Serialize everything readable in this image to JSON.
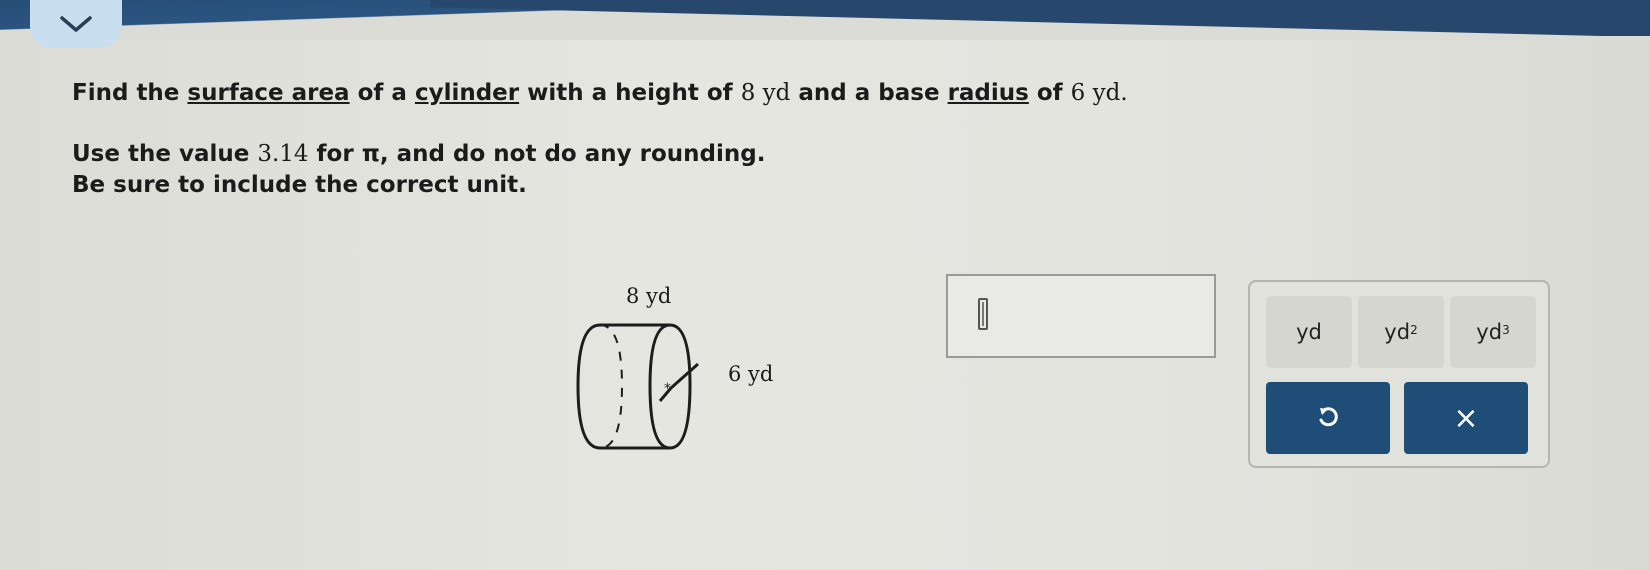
{
  "header": {
    "collapse_icon": "chevron-down-icon"
  },
  "question": {
    "line1_prefix": "Find the ",
    "term_surface_area": "surface area",
    "line1_mid1": " of a ",
    "term_cylinder": "cylinder",
    "line1_mid2": " with a height of ",
    "height_value": "8 yd",
    "line1_mid3": " and a base ",
    "term_radius": "radius",
    "line1_mid4": " of ",
    "radius_value": "6 yd",
    "line1_end": ".",
    "line2_prefix": "Use the value ",
    "pi_value": "3.14",
    "line2_suffix": " for π, and do not do any rounding.",
    "line3": "Be sure to include the correct unit."
  },
  "figure": {
    "height_label": "8 yd",
    "radius_label": "6 yd"
  },
  "answer": {
    "value": ""
  },
  "keypad": {
    "units": [
      {
        "base": "yd",
        "exp": ""
      },
      {
        "base": "yd",
        "exp": "2"
      },
      {
        "base": "yd",
        "exp": "3"
      }
    ],
    "undo_icon": "undo-icon",
    "clear_label": "×"
  }
}
